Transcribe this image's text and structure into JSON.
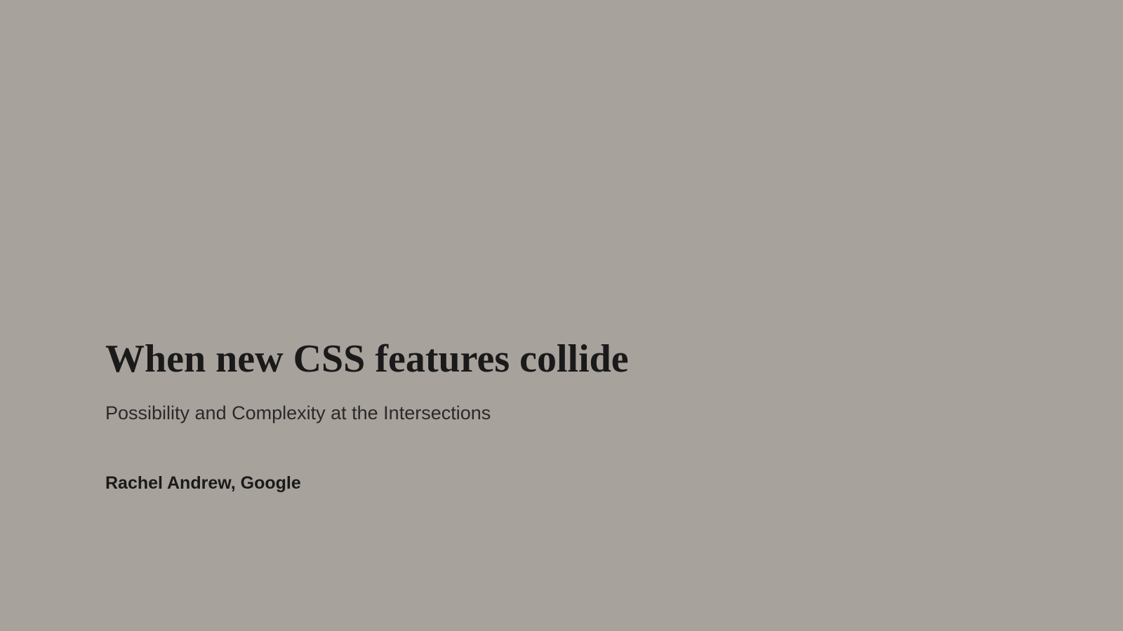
{
  "slide": {
    "title": "When new CSS features collide",
    "subtitle": "Possibility and Complexity at the Intersections",
    "author": "Rachel Andrew, Google"
  }
}
